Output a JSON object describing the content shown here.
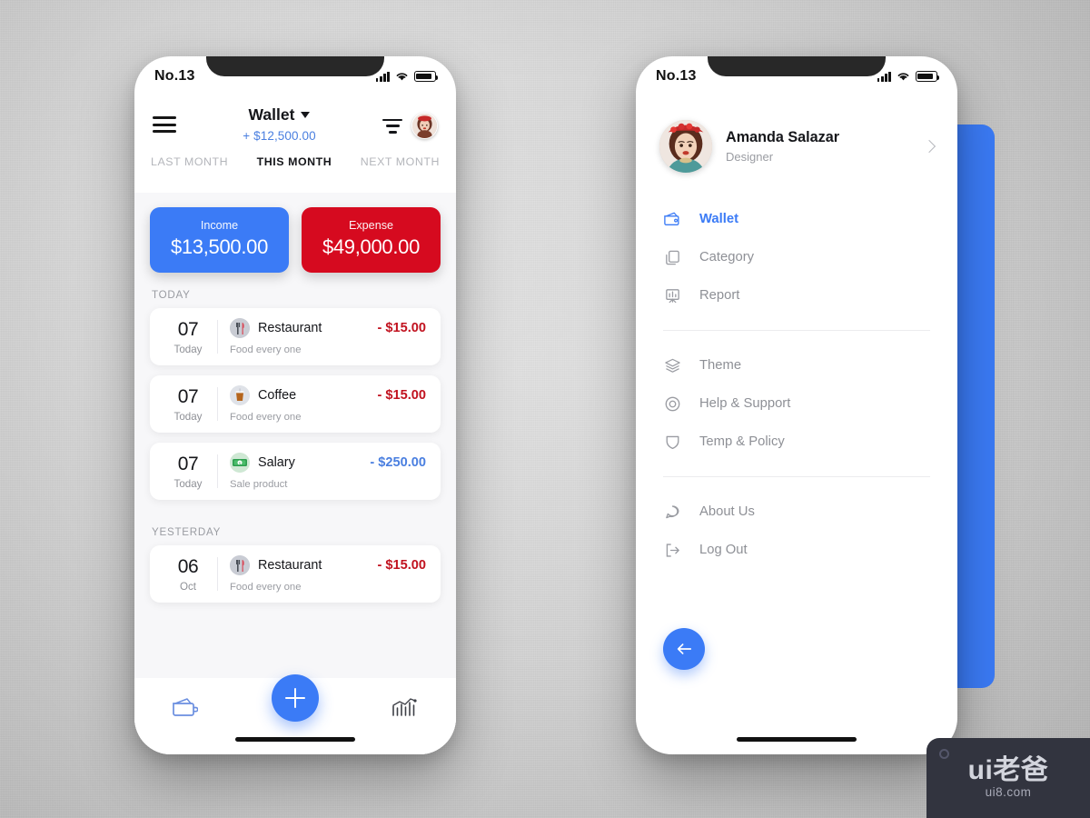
{
  "background": {
    "base_color": "#d5d5d5"
  },
  "wallet_screen": {
    "status_bar": {
      "carrier": "No.13",
      "icons": [
        "signal-icon",
        "wifi-icon",
        "battery-icon"
      ]
    },
    "header": {
      "menu_icon": "hamburger-icon",
      "title": "Wallet",
      "title_caret": "chevron-down-icon",
      "balance": "+ $12,500.00",
      "filter_icon": "filter-icon",
      "avatar": "user-avatar"
    },
    "month_tabs": [
      {
        "label": "LAST MONTH",
        "active": false
      },
      {
        "label": "THIS MONTH",
        "active": true
      },
      {
        "label": "NEXT MONTH",
        "active": false
      }
    ],
    "summary_cards": [
      {
        "label": "Income",
        "value": "$13,500.00",
        "color": "#3b7bf6"
      },
      {
        "label": "Expense",
        "value": "$49,000.00",
        "color": "#d60a1f"
      }
    ],
    "sections": [
      {
        "label": "TODAY",
        "transactions": [
          {
            "day": "07",
            "sub": "Today",
            "icon": "restaurant-icon",
            "name": "Restaurant",
            "note": "Food every one",
            "amount": "- $15.00",
            "amount_color": "#c1121f"
          },
          {
            "day": "07",
            "sub": "Today",
            "icon": "coffee-icon",
            "name": "Coffee",
            "note": "Food every one",
            "amount": "- $15.00",
            "amount_color": "#c1121f"
          },
          {
            "day": "07",
            "sub": "Today",
            "icon": "salary-icon",
            "name": "Salary",
            "note": "Sale product",
            "amount": "- $250.00",
            "amount_color": "#4a7fe0"
          }
        ]
      },
      {
        "label": "YESTERDAY",
        "transactions": [
          {
            "day": "06",
            "sub": "Oct",
            "icon": "restaurant-icon",
            "name": "Restaurant",
            "note": "Food every one",
            "amount": "- $15.00",
            "amount_color": "#c1121f"
          }
        ]
      }
    ],
    "bottom_nav": {
      "left_icon": "wallet-icon",
      "add_icon": "plus-icon",
      "right_icon": "bar-chart-icon"
    }
  },
  "drawer_screen": {
    "status_bar": {
      "carrier": "No.13",
      "icons": [
        "signal-icon",
        "wifi-icon",
        "battery-icon"
      ]
    },
    "profile": {
      "avatar": "user-avatar",
      "name": "Amanda Salazar",
      "role": "Designer",
      "chevron": "chevron-right-icon"
    },
    "menu_primary": [
      {
        "icon": "wallet-icon",
        "label": "Wallet",
        "active": true
      },
      {
        "icon": "category-icon",
        "label": "Category",
        "active": false
      },
      {
        "icon": "report-icon",
        "label": "Report",
        "active": false
      }
    ],
    "menu_secondary": [
      {
        "icon": "layers-icon",
        "label": "Theme",
        "active": false
      },
      {
        "icon": "help-circle-icon",
        "label": "Help & Support",
        "active": false
      },
      {
        "icon": "shield-icon",
        "label": "Temp & Policy",
        "active": false
      }
    ],
    "menu_tertiary": [
      {
        "icon": "chat-bubble-icon",
        "label": "About Us",
        "active": false
      },
      {
        "icon": "logout-icon",
        "label": "Log Out",
        "active": false
      }
    ],
    "back_button": {
      "icon": "arrow-left-icon"
    }
  },
  "watermark": {
    "main": "ui老爸",
    "sub": "ui8.com"
  },
  "colors": {
    "accent": "#3b7bf6",
    "danger": "#d60a1f",
    "muted": "#9a9ca2"
  }
}
